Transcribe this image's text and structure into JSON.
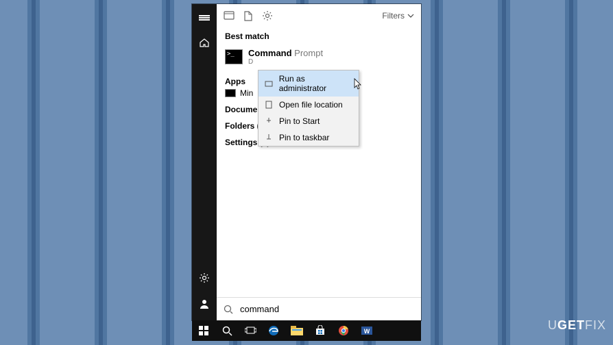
{
  "toolbar": {
    "filters_label": "Filters"
  },
  "sections": {
    "best_match": "Best match",
    "apps": "Apps",
    "documents": "Documents (1)",
    "folders": "Folders (13)",
    "settings": "Settings (4)"
  },
  "best_match_result": {
    "title_prefix": "Command",
    "title_suffix": " Prompt",
    "subtitle_initial": "D"
  },
  "apps_result": {
    "label": "Min"
  },
  "context_menu": {
    "items": [
      {
        "label": "Run as administrator",
        "highlight": true
      },
      {
        "label": "Open file location",
        "highlight": false
      },
      {
        "label": "Pin to Start",
        "highlight": false
      },
      {
        "label": "Pin to taskbar",
        "highlight": false
      }
    ]
  },
  "search": {
    "value": "command"
  },
  "watermark": {
    "text_a": "U",
    "text_b": "GET",
    "text_c": "FIX"
  }
}
